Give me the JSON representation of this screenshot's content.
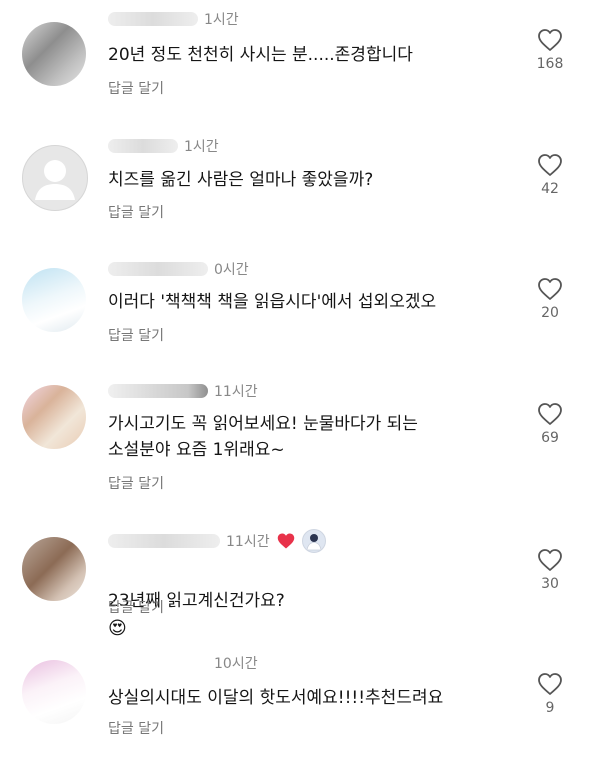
{
  "comments": [
    {
      "time": "1시간",
      "text": "20년 정도 천천히 사시는 분.....존경합니다",
      "reply": "답글 달기",
      "likes": "168"
    },
    {
      "time": "1시간",
      "text": "치즈를 옮긴 사람은 얼마나 좋았을까?",
      "reply": "답글 달기",
      "likes": "42"
    },
    {
      "time": "0시간",
      "text": "이러다 '책책책 책을 읽읍시다'에서 섭외오겠오",
      "reply": "답글 달기",
      "likes": "20"
    },
    {
      "time": "11시간",
      "text": "가시고기도 꼭 읽어보세요! 눈물바다가 되는\n소설분야 요즘 1위래요~",
      "reply": "답글 달기",
      "likes": "69"
    },
    {
      "time": "11시간",
      "text": "23년째 읽고계신건가요?",
      "emoji": "😍",
      "reply": "답글 달기",
      "likes": "30"
    },
    {
      "time": "10시간",
      "text": "상실의시대도 이달의 핫도서예요!!!!추천드려요",
      "reply": "답글 달기",
      "likes": "9"
    }
  ],
  "icons": {
    "like": "heart-outline-icon",
    "creator_like": "heart-filled-icon"
  },
  "colors": {
    "creator_heart": "#e8324a",
    "meta_text": "#888888",
    "like_outline": "#555555"
  }
}
